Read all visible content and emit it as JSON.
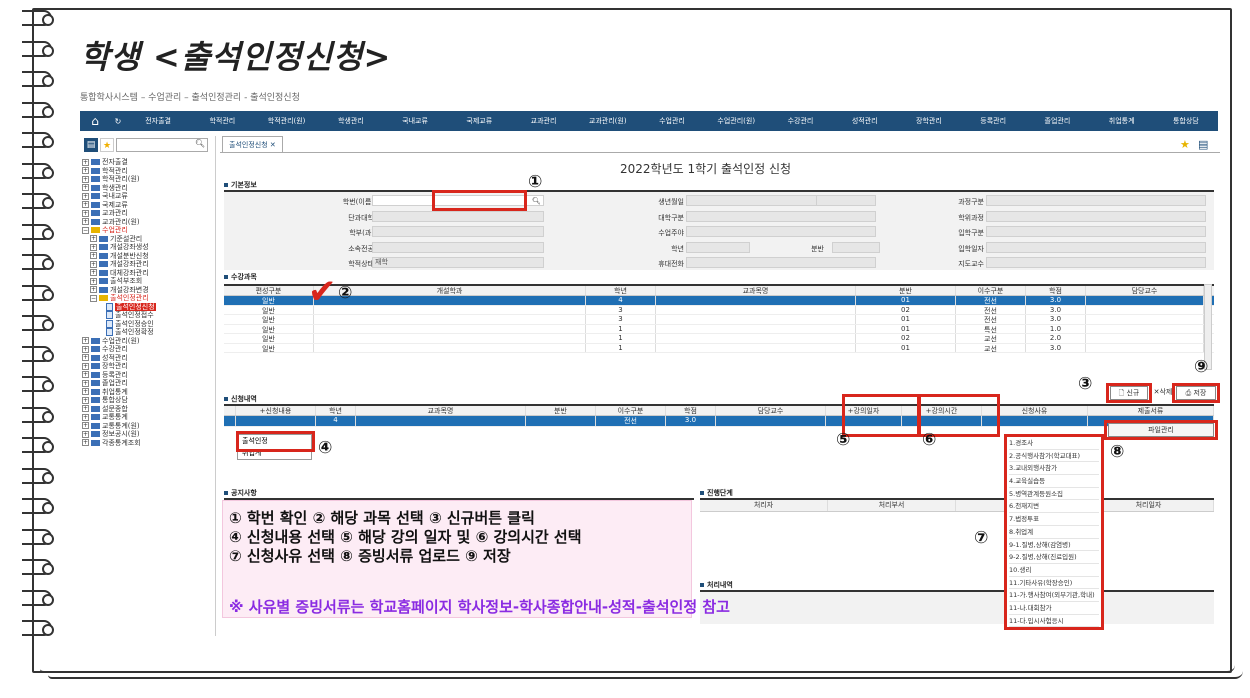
{
  "page_title": "학생 <출석인정신청>",
  "breadcrumb": "통합학사시스템 – 수업관리 – 출석인정관리 - 출석인정신청",
  "menu": [
    "전자출결",
    "학적관리",
    "학적관리(원)",
    "학생관리",
    "국내교류",
    "국제교류",
    "교과관리",
    "교과관리(원)",
    "수업관리",
    "수업관리(원)",
    "수강관리",
    "성적관리",
    "장학관리",
    "등록관리",
    "졸업관리",
    "취업통계",
    "통합상담"
  ],
  "sidebar": [
    "전자출결",
    "학적관리",
    "학적관리(원)",
    "학생관리",
    "국내교류",
    "국제교류",
    "교과관리",
    "교과관리(원)",
    "수업관리",
    "기준설관리",
    "개설강좌생성",
    "개설분반신청",
    "개설강좌관리",
    "대체강좌관리",
    "출석부조회",
    "개설강좌변경",
    "출석인정관리",
    "출석인정신청",
    "출석인정접수",
    "출석인정승인",
    "출석인정확정",
    "수업관리(원)",
    "수강관리",
    "성적관리",
    "장학관리",
    "등록관리",
    "졸업관리",
    "취업통계",
    "통합상담",
    "설문종합",
    "교통통계",
    "교통통계(원)",
    "정보공시(원)",
    "각종통계조회"
  ],
  "tab": "출석인정신청 ✕",
  "heading": "2022학년도 1학기 출석인정 신청",
  "sections": {
    "basic": "기본정보",
    "courses": "수강과목",
    "apply": "신청내역",
    "notice": "공지사항",
    "progress": "진행단계",
    "history": "처리내역"
  },
  "basic_labels": [
    "학번(이름)",
    "단과대학",
    "학부(과)",
    "소속전공",
    "학적상태",
    "생년월일",
    "대학구분",
    "수업주야",
    "학년",
    "휴대전화",
    "분반",
    "과정구분",
    "학위과정",
    "입학구분",
    "입학일자",
    "지도교수"
  ],
  "basic_values": {
    "status": "재학"
  },
  "course_headers": [
    "편성구분",
    "개설학과",
    "학년",
    "교과목명",
    "분반",
    "이수구분",
    "학점",
    "담당교수"
  ],
  "course_rows": [
    [
      "일반",
      "",
      "4",
      "",
      "01",
      "전선",
      "3.0",
      ""
    ],
    [
      "일반",
      "",
      "3",
      "",
      "02",
      "전선",
      "3.0",
      ""
    ],
    [
      "일반",
      "",
      "3",
      "",
      "01",
      "전선",
      "3.0",
      ""
    ],
    [
      "일반",
      "",
      "1",
      "",
      "01",
      "특선",
      "1.0",
      ""
    ],
    [
      "일반",
      "",
      "1",
      "",
      "02",
      "교선",
      "2.0",
      ""
    ],
    [
      "일반",
      "",
      "1",
      "",
      "01",
      "교선",
      "3.0",
      ""
    ]
  ],
  "apply_headers": [
    "",
    "+신청내용",
    "학년",
    "교과목명",
    "분반",
    "이수구분",
    "학점",
    "담당교수",
    "+강의일자",
    "+강의시간",
    "신청사유",
    "제출서류"
  ],
  "apply_row": [
    "",
    "",
    "4",
    "",
    "",
    "전선",
    "3.0",
    "",
    "",
    "",
    "",
    ""
  ],
  "apply_options": [
    "출석인정",
    "취업계"
  ],
  "buttons": {
    "new": "신규",
    "delete": "삭제",
    "save": "저장",
    "files": "파일관리"
  },
  "progress_headers": [
    "처리자",
    "처리부서",
    "진행단계",
    "처리일자"
  ],
  "reasons": [
    "1.경조사",
    "2.공식행사참가(학교대표)",
    "3.교내외행사참가",
    "4.교육실습등",
    "5.병역관계등원소집",
    "6.천재지변",
    "7.법정투표",
    "8.취업계",
    "9-1.질병,상해(감염병)",
    "9-2.질병,상해(진료입원)",
    "10.생리",
    "11.기타사유(학장승인)",
    "11-가.행사참여(외부기관,학내)",
    "11-나.대회참가",
    "11-다.입시사험응시"
  ],
  "steps": [
    "① 학번 확인 ② 해당 과목 선택 ③ 신규버튼 클릭",
    "④ 신청내용 선택 ⑤ 해당 강의 일자 및 ⑥ 강의시간 선택",
    "⑦ 신청사유 선택 ⑧ 증빙서류 업로드 ⑨ 저장"
  ],
  "note": "※ 사유별 증빙서류는 학교홈페이지 학사정보-학사종합안내-성적-출석인정 참고",
  "markers": [
    "①",
    "②",
    "③",
    "④",
    "⑤",
    "⑥",
    "⑦",
    "⑧",
    "⑨"
  ],
  "colors": {
    "menubar": "#1f4e79",
    "highlight": "#d8261c",
    "selected_row": "#1f6fb4"
  }
}
